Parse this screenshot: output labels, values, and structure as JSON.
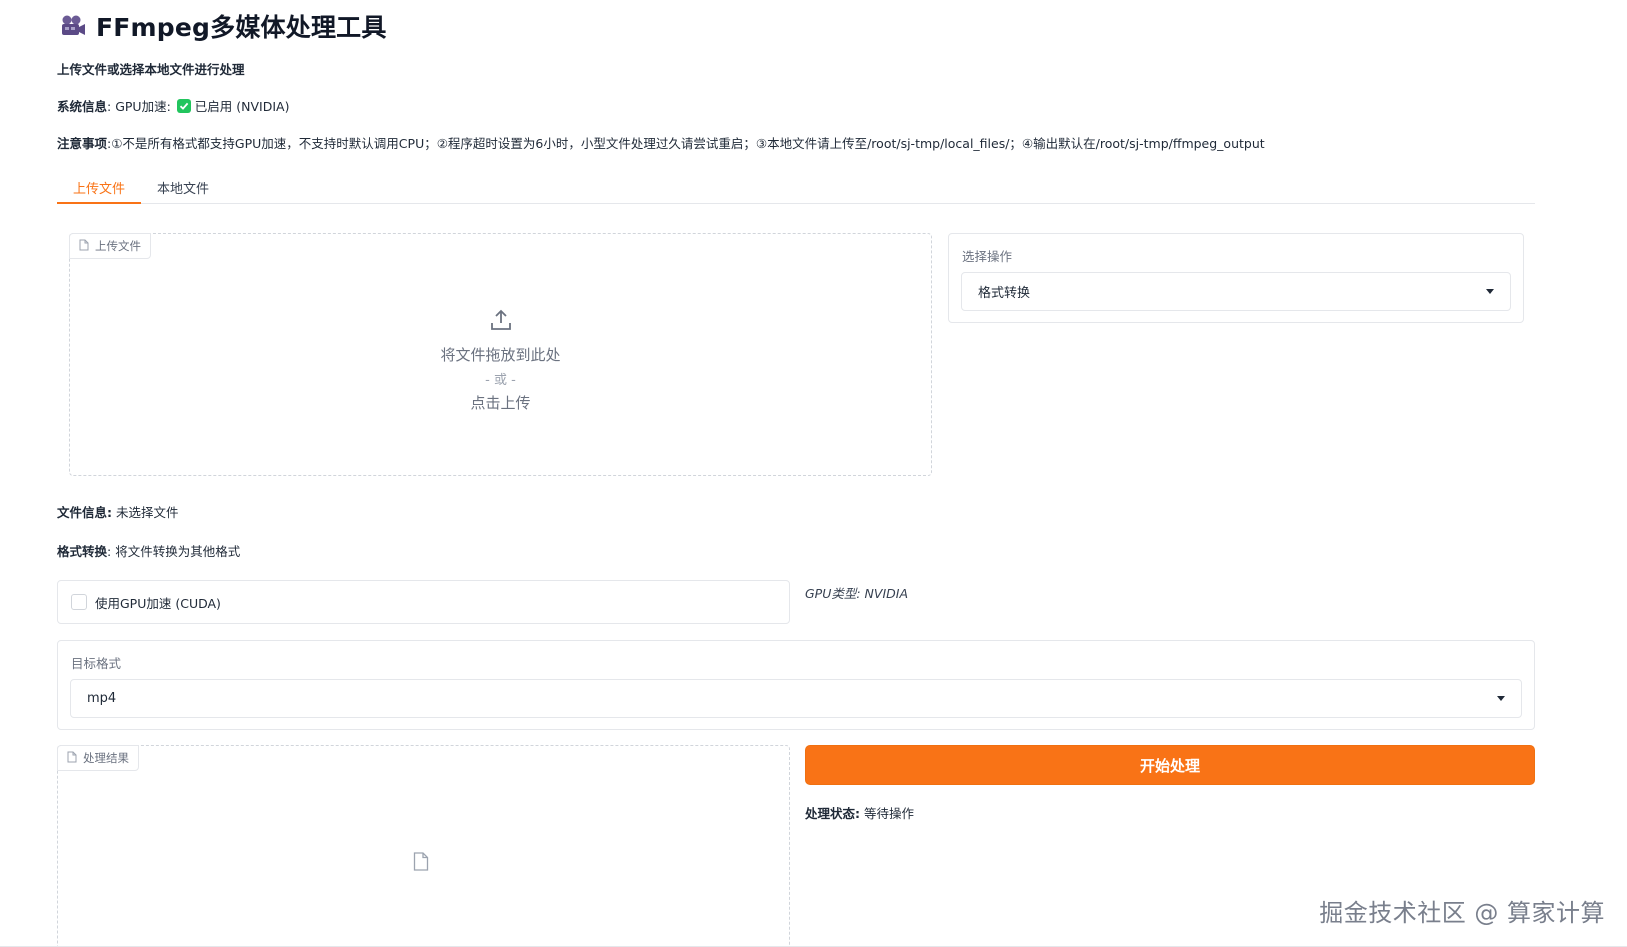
{
  "app": {
    "title": "FFmpeg多媒体处理工具",
    "subtitle": "上传文件或选择本地文件进行处理"
  },
  "system_info": {
    "label": "系统信息",
    "gpu_label": ": GPU加速: ",
    "gpu_status": "已启用 (NVIDIA)"
  },
  "notice": {
    "label": "注意事项",
    "text": ":①不是所有格式都支持GPU加速，不支持时默认调用CPU；②程序超时设置为6小时，小型文件处理过久请尝试重启；③本地文件请上传至/root/sj-tmp/local_files/；④输出默认在/root/sj-tmp/ffmpeg_output"
  },
  "tabs": [
    {
      "label": "上传文件",
      "active": true
    },
    {
      "label": "本地文件",
      "active": false
    }
  ],
  "upload": {
    "label": "上传文件",
    "drop_text": "将文件拖放到此处",
    "or_text": "- 或 -",
    "click_text": "点击上传"
  },
  "operation": {
    "label": "选择操作",
    "value": "格式转换"
  },
  "file_info": {
    "label": "文件信息:",
    "value": " 未选择文件"
  },
  "format_convert": {
    "label": "格式转换",
    "desc": ": 将文件转换为其他格式"
  },
  "gpu_option": {
    "label": "使用GPU加速 (CUDA)",
    "checked": false,
    "gpu_type": "GPU类型: NVIDIA"
  },
  "target_format": {
    "label": "目标格式",
    "value": "mp4"
  },
  "result": {
    "label": "处理结果"
  },
  "start_button": {
    "label": "开始处理"
  },
  "status": {
    "label": "处理状态:",
    "value": " 等待操作"
  },
  "watermark": "掘金技术社区 @ 算家计算",
  "colors": {
    "accent": "#f97316",
    "success": "#22c55e",
    "border": "#e5e7eb"
  }
}
